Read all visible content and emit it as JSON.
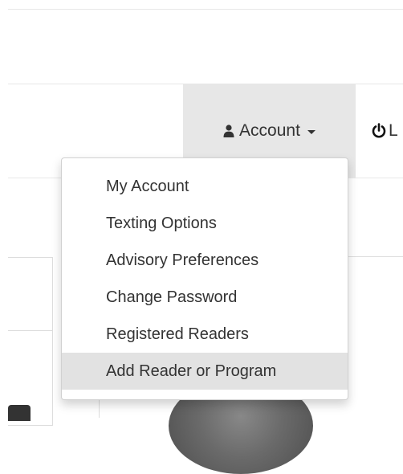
{
  "navbar": {
    "account": {
      "icon": "user-icon",
      "label": "Account",
      "caret": "caret-down-icon"
    },
    "logout": {
      "icon": "power-icon",
      "label": "L"
    }
  },
  "account_menu": {
    "items": [
      {
        "label": "My Account"
      },
      {
        "label": "Texting Options"
      },
      {
        "label": "Advisory Preferences"
      },
      {
        "label": "Change Password"
      },
      {
        "label": "Registered Readers"
      },
      {
        "label": "Add Reader or Program",
        "highlighted": true
      }
    ]
  },
  "colors": {
    "text": "#333333",
    "nav_active_bg": "#e7e7e7",
    "menu_hover_bg": "#e2e2e2",
    "border": "#dddddd"
  }
}
